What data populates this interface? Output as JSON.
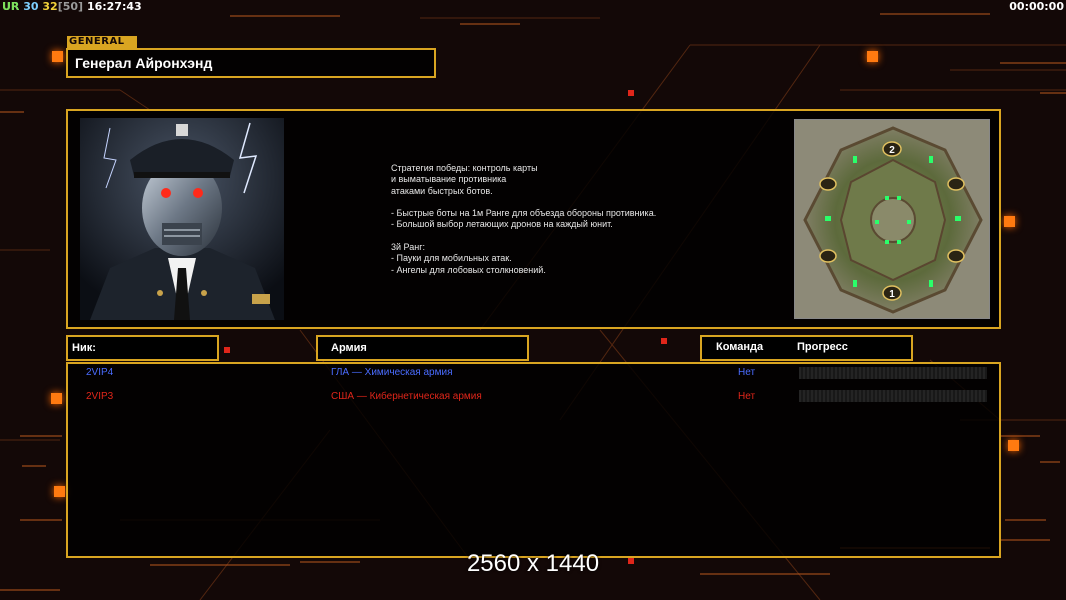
{
  "hud": {
    "ur_label": "UR",
    "stat1": "30",
    "stat2": "32",
    "stat3": "[50]",
    "clock": "16:27:43",
    "timer": "00:00:00"
  },
  "general": {
    "tag": "GENERAL",
    "name": "Генерал Айронхэнд",
    "portrait_icon": "cyborg-general-portrait",
    "map_icon": "battle-map-minimap",
    "strategy_lines": [
      "Стратегия победы: контроль карты",
      "и выматывание противника",
      "атаками быстрых ботов.",
      "",
      "- Быстрые боты на 1м Ранге для объезда обороны противника.",
      "- Большой выбор летающих дронов на каждый юнит.",
      "",
      "3й Ранг:",
      "- Пауки для мобильных атак.",
      "- Ангелы для лобовых столкновений."
    ]
  },
  "map": {
    "slot_top": "2",
    "slot_bottom": "1"
  },
  "table": {
    "headers": {
      "nick": "Ник:",
      "army": "Армия",
      "team": "Команда",
      "progress": "Прогресс"
    },
    "rows": [
      {
        "nick": "2VIP4",
        "army": "ГЛА — Химическая армия",
        "team": "Нет",
        "color": "#4a6cff",
        "progress": 0
      },
      {
        "nick": "2VIP3",
        "army": "США — Кибернетическая армия",
        "team": "Нет",
        "color": "#e0261a",
        "progress": 0
      }
    ]
  },
  "resolution": "2560 x 1440",
  "colors": {
    "accent": "#d9a521",
    "background": "#130807",
    "glow": "#ff7a10",
    "player_blue": "#4a6cff",
    "player_red": "#e0261a"
  }
}
